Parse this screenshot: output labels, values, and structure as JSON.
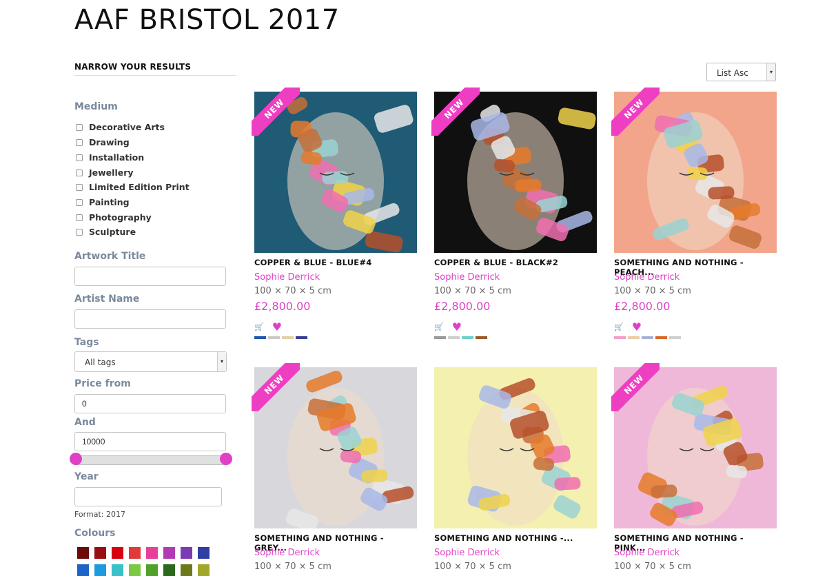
{
  "page": {
    "title": "AAF BRISTOL 2017"
  },
  "sidebar": {
    "heading": "NARROW YOUR RESULTS",
    "medium_label": "Medium",
    "medium_options": [
      "Decorative Arts",
      "Drawing",
      "Installation",
      "Jewellery",
      "Limited Edition Print",
      "Painting",
      "Photography",
      "Sculpture"
    ],
    "artwork_title_label": "Artwork Title",
    "artwork_title_value": "",
    "artist_name_label": "Artist Name",
    "artist_name_value": "",
    "tags_label": "Tags",
    "tags_selected": "All tags",
    "price_from_label": "Price from",
    "price_from_value": "0",
    "price_to_label": "And",
    "price_to_value": "10000",
    "price_slider": {
      "min_fraction": 0,
      "max_fraction": 1
    },
    "year_label": "Year",
    "year_value": "",
    "year_hint": "Format: 2017",
    "colours_label": "Colours",
    "colours_row1": [
      "#6b0a0a",
      "#9a0d12",
      "#d7000f",
      "#e03a3a",
      "#e8409a",
      "#b23bb3",
      "#7b3bb2",
      "#2f3ea3"
    ],
    "colours_row2": [
      "#1e63c7",
      "#1e9be0",
      "#39c0c8",
      "#7ac943",
      "#4fa12a",
      "#2b6a1a",
      "#6e7a1a",
      "#a0a72a"
    ]
  },
  "sort": {
    "selected": "List Asc"
  },
  "new_badge": "NEW",
  "products": [
    {
      "title": "COPPER & BLUE - BLUE#4",
      "artist": "Sophie Derrick",
      "dims": "100 × 70 × 5 cm",
      "price": "£2,800.00",
      "is_new": true,
      "palette": [
        "#1d5aa8",
        "#c9c9c9",
        "#e6cfa6",
        "#3a3f8f"
      ],
      "bg": "#1f5b74"
    },
    {
      "title": "COPPER & BLUE - BLACK#2",
      "artist": "Sophie Derrick",
      "dims": "100 × 70 × 5 cm",
      "price": "£2,800.00",
      "is_new": true,
      "palette": [
        "#9a9a9a",
        "#cfcfcf",
        "#6fcfcf",
        "#9a5a2a"
      ],
      "bg": "#101010"
    },
    {
      "title": "SOMETHING AND NOTHING - PEACH...",
      "artist": "Sophie Derrick",
      "dims": "100 × 70 × 5 cm",
      "price": "£2,800.00",
      "is_new": true,
      "palette": [
        "#f3a0c8",
        "#e8cfa8",
        "#a8b2d8",
        "#d9682a",
        "#cfcfcf"
      ],
      "bg": "#f2a58a"
    },
    {
      "title": "SOMETHING AND NOTHING - GREY...",
      "artist": "Sophie Derrick",
      "dims": "100 × 70 × 5 cm",
      "price": "",
      "is_new": true,
      "palette": [],
      "bg": "#d8d8dc"
    },
    {
      "title": "SOMETHING AND NOTHING -...",
      "artist": "Sophie Derrick",
      "dims": "100 × 70 × 5 cm",
      "price": "",
      "is_new": false,
      "palette": [],
      "bg": "#f4f0b0"
    },
    {
      "title": "SOMETHING AND NOTHING - PINK...",
      "artist": "Sophie Derrick",
      "dims": "100 × 70 × 5 cm",
      "price": "",
      "is_new": true,
      "palette": [],
      "bg": "#f0b8d8"
    }
  ]
}
